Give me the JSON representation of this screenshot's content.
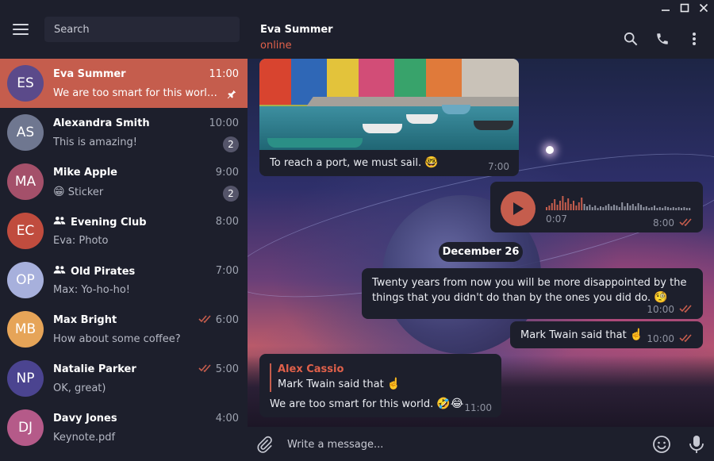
{
  "sidebar": {
    "search_placeholder": "Search",
    "chats": [
      {
        "initials": "ES",
        "name": "Eva Summer",
        "time": "11:00",
        "preview": "We are too smart for this world. 🤣😂",
        "color": "#5b4a8a",
        "pinned": true
      },
      {
        "initials": "AS",
        "name": "Alexandra Smith",
        "time": "10:00",
        "preview": "This is amazing!",
        "badge": "2",
        "color": "#6f7790"
      },
      {
        "initials": "MA",
        "name": "Mike Apple",
        "time": "9:00",
        "preview": "Sticker",
        "preview_emoji": "😁",
        "badge": "2",
        "color": "#a4506a"
      },
      {
        "initials": "EC",
        "name": "Evening Club",
        "time": "8:00",
        "preview": "Eva: Photo",
        "group": true,
        "color": "#c04c3e"
      },
      {
        "initials": "OP",
        "name": "Old Pirates",
        "time": "7:00",
        "preview": "Max: Yo-ho-ho!",
        "group": true,
        "color": "#a7b0dc"
      },
      {
        "initials": "MB",
        "name": "Max Bright",
        "time": "6:00",
        "preview": "How about some coffee?",
        "read": true,
        "color": "#e6a458"
      },
      {
        "initials": "NP",
        "name": "Natalie Parker",
        "time": "5:00",
        "preview": "OK, great)",
        "read": true,
        "color": "#4b4490"
      },
      {
        "initials": "DJ",
        "name": "Davy Jones",
        "time": "4:00",
        "preview": "Keynote.pdf",
        "color": "#b55a89"
      }
    ]
  },
  "header": {
    "name": "Eva Summer",
    "status": "online"
  },
  "messages": {
    "photo_caption": "To reach a port, we must sail.",
    "photo_caption_emoji": "🤓",
    "photo_time": "7:00",
    "voice_duration": "0:07",
    "voice_time": "8:00",
    "date_separator": "December 26",
    "msg1_text": "Twenty years from now you will be more disappointed by the things that you didn't do than by the ones you did do.",
    "msg1_emoji": "🧐",
    "msg1_time": "10:00",
    "msg2_text": "Mark Twain said that",
    "msg2_emoji": "☝️",
    "msg2_time": "10:00",
    "reply_name": "Alex Cassio",
    "reply_text": "Mark Twain said that",
    "reply_emoji": "☝️",
    "msg3_text": "We are too smart for this world.",
    "msg3_emoji": "🤣😂",
    "msg3_time": "11:00"
  },
  "composer": {
    "placeholder": "Write a message..."
  },
  "colors": {
    "accent": "#c55d4d",
    "panel": "#1d1f2c",
    "status_online": "#e0604a"
  },
  "icons": {
    "menu": "hamburger-icon",
    "search": "search-icon",
    "call": "phone-icon",
    "more": "more-vertical-icon",
    "attach": "paperclip-icon",
    "emoji": "smile-icon",
    "mic": "microphone-icon",
    "play": "play-icon",
    "pin": "pin-icon",
    "group": "group-icon",
    "read": "double-check-icon"
  }
}
